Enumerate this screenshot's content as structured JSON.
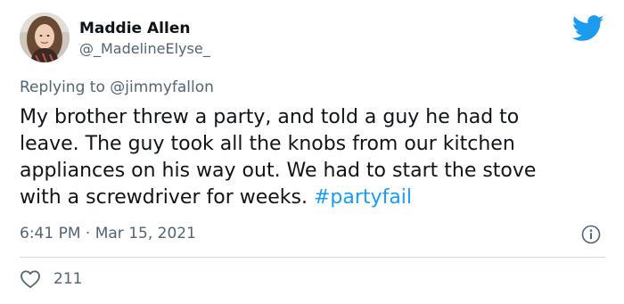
{
  "author": {
    "display_name": "Maddie Allen",
    "handle": "@_MadelineElyse_"
  },
  "reply": {
    "prefix": "Replying to",
    "mention": "@jimmyfallon"
  },
  "tweet": {
    "lines": [
      "My brother threw a party, and told a guy he had to",
      "leave. The guy took all the knobs from our kitchen",
      "appliances on his way out. We had to start the stove",
      "with a screwdriver for weeks. "
    ],
    "hashtag": "#partyfail",
    "time": "6:41 PM",
    "separator": "·",
    "date": "Mar 15, 2021"
  },
  "stats": {
    "likes": "211"
  },
  "icons": {
    "brand": "twitter-bird-icon",
    "info": "info-icon",
    "like": "heart-icon"
  },
  "colors": {
    "accent": "#1d9bf0",
    "text_primary": "#0f1419",
    "text_secondary": "#536471",
    "divider": "#cfd9de"
  }
}
